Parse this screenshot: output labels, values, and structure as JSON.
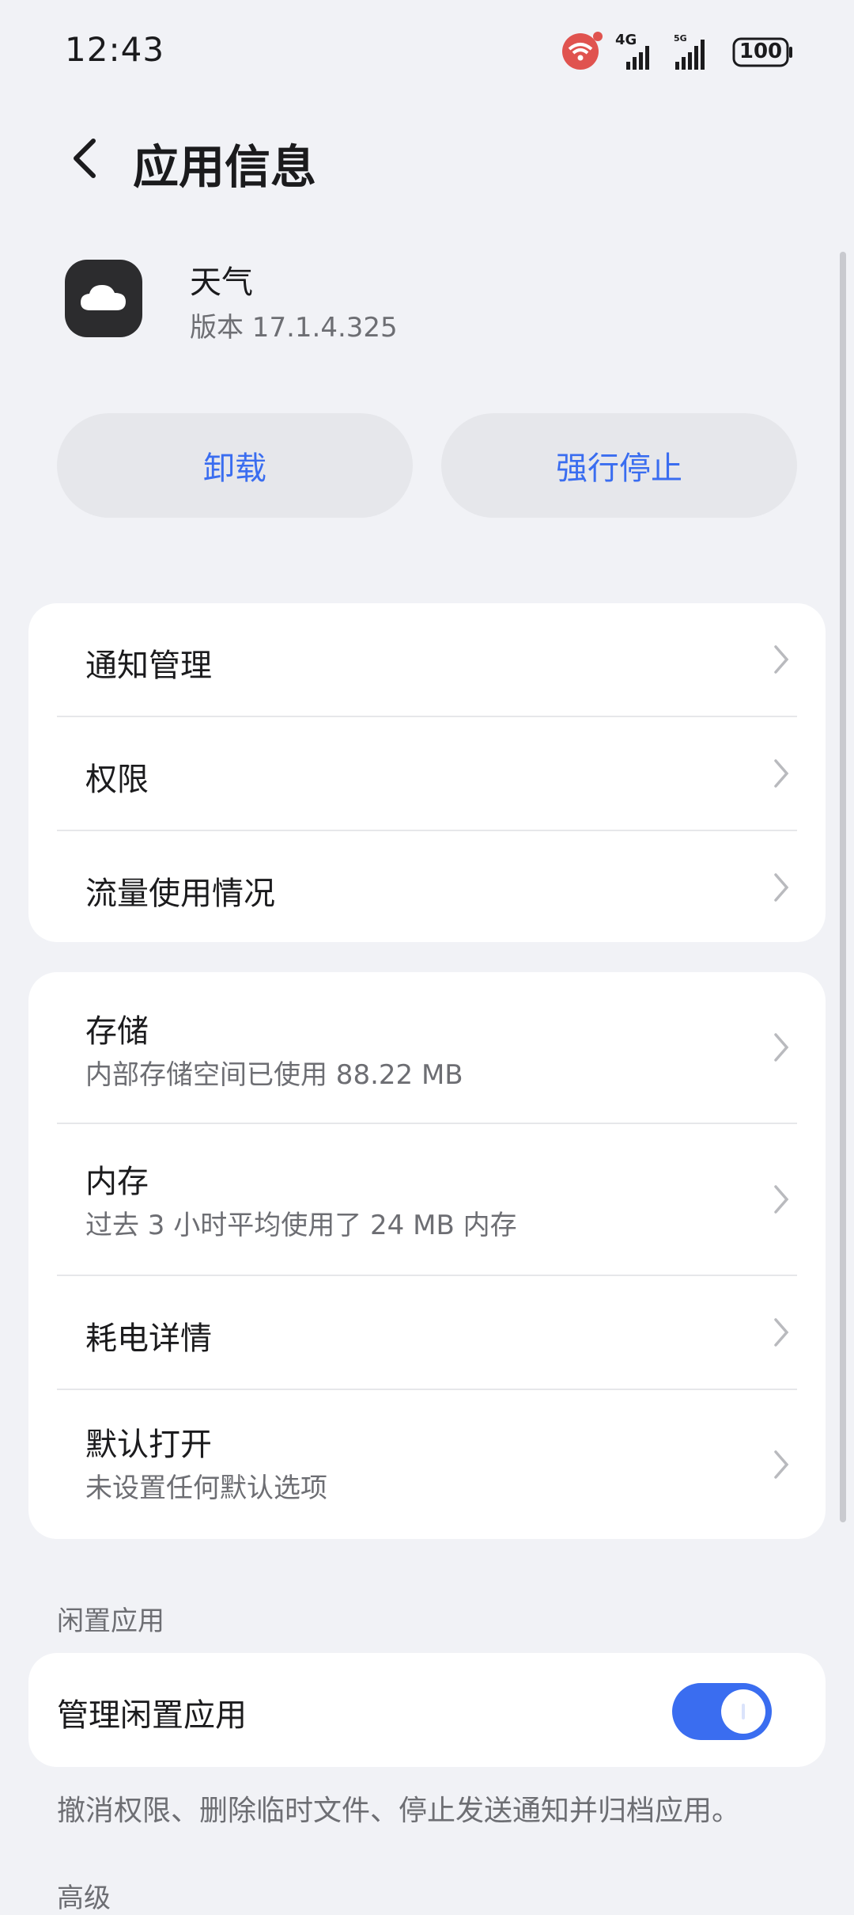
{
  "status_bar": {
    "time": "12:43",
    "network_1": "4G",
    "network_2": "5G",
    "battery": "100"
  },
  "header": {
    "title": "应用信息"
  },
  "app": {
    "name": "天气",
    "version": "版本 17.1.4.325"
  },
  "actions": {
    "uninstall": "卸载",
    "force_stop": "强行停止"
  },
  "group1": [
    {
      "label": "通知管理"
    },
    {
      "label": "权限"
    },
    {
      "label": "流量使用情况"
    }
  ],
  "group2": [
    {
      "label": "存储",
      "sub": "内部存储空间已使用 88.22 MB"
    },
    {
      "label": "内存",
      "sub": "过去 3 小时平均使用了 24 MB 内存"
    },
    {
      "label": "耗电详情"
    },
    {
      "label": "默认打开",
      "sub": "未设置任何默认选项"
    }
  ],
  "idle": {
    "section_title": "闲置应用",
    "toggle_label": "管理闲置应用",
    "toggle_on": true,
    "description": "撤消权限、删除临时文件、停止发送通知并归档应用。"
  },
  "advanced": {
    "section_title": "高级"
  },
  "colors": {
    "accent": "#3a6df0",
    "background": "#f1f2f6",
    "card": "#ffffff"
  }
}
